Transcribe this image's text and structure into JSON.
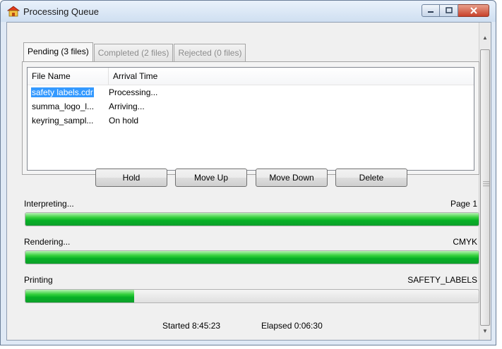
{
  "window": {
    "title": "Processing Queue",
    "controls": [
      "minimize-icon",
      "maximize-icon",
      "close-icon"
    ]
  },
  "tabs": [
    {
      "label": "Pending (3 files)",
      "active": true
    },
    {
      "label": "Completed (2 files)",
      "active": false
    },
    {
      "label": "Rejected (0 files)",
      "active": false
    }
  ],
  "list": {
    "columns": [
      "File Name",
      "Arrival Time"
    ],
    "rows": [
      {
        "file": "safety labels.cdr",
        "status": "Processing...",
        "selected": true
      },
      {
        "file": "summa_logo_l...",
        "status": "Arriving...",
        "selected": false
      },
      {
        "file": "keyring_sampl...",
        "status": "On hold",
        "selected": false
      }
    ]
  },
  "buttons": {
    "hold": "Hold",
    "move_up": "Move Up",
    "move_down": "Move Down",
    "delete": "Delete"
  },
  "stages": [
    {
      "label": "Interpreting...",
      "info": "Page 1",
      "progress_percent": 100
    },
    {
      "label": "Rendering...",
      "info": "CMYK",
      "progress_percent": 100
    },
    {
      "label": "Printing",
      "info": "SAFETY_LABELS",
      "progress_percent": 24
    }
  ],
  "footer": {
    "started": "Started 8:45:23",
    "elapsed": "Elapsed 0:06:30"
  },
  "colors": {
    "selection": "#3399ff",
    "progress_green": "#06b025",
    "close_button": "#c8412b"
  }
}
